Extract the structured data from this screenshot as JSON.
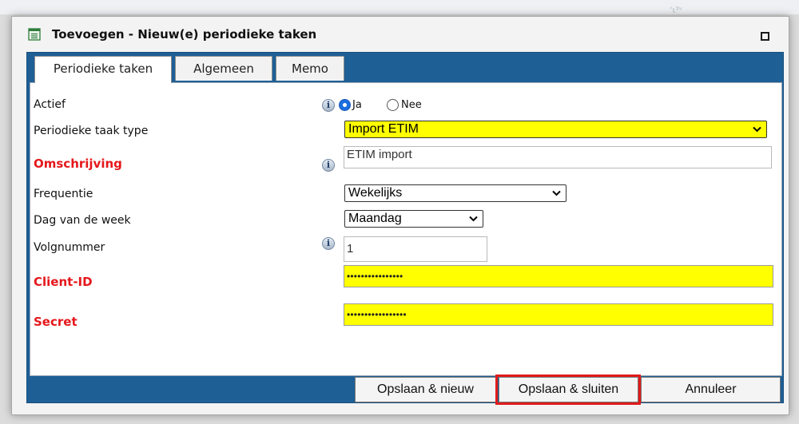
{
  "dialog": {
    "title": "Toevoegen - Nieuw(e) periodieke taken",
    "icons": {
      "title": "form-icon",
      "window": "maximize-icon"
    }
  },
  "tabs": [
    {
      "label": "Periodieke taken",
      "active": true
    },
    {
      "label": "Algemeen",
      "active": false
    },
    {
      "label": "Memo",
      "active": false
    }
  ],
  "form": {
    "actief": {
      "label": "Actief",
      "options": [
        "Ja",
        "Nee"
      ],
      "selected": "Ja"
    },
    "taak_type": {
      "label": "Periodieke taak type",
      "value": "Import ETIM"
    },
    "omschrijving": {
      "label": "Omschrijving",
      "value": "ETIM import",
      "required": true
    },
    "frequentie": {
      "label": "Frequentie",
      "value": "Wekelijks"
    },
    "dag": {
      "label": "Dag van de week",
      "value": "Maandag"
    },
    "volgnummer": {
      "label": "Volgnummer",
      "value": "1"
    },
    "client_id": {
      "label": "Client-ID",
      "value": "••••••••••••••••",
      "required": true
    },
    "secret": {
      "label": "Secret",
      "value": "•••••••••••••••••",
      "required": true
    }
  },
  "footer": {
    "save_new": "Opslaan & nieuw",
    "save_close": "Opslaan & sluiten",
    "cancel": "Annuleer"
  },
  "background_text": "ʻɩ³ᵛ",
  "colors": {
    "panel": "#1e5f96",
    "required": "#e5171b",
    "highlight_field": "#ffff00",
    "annotation_box": "#e01b1b",
    "radio_on": "#1a6fe0"
  }
}
